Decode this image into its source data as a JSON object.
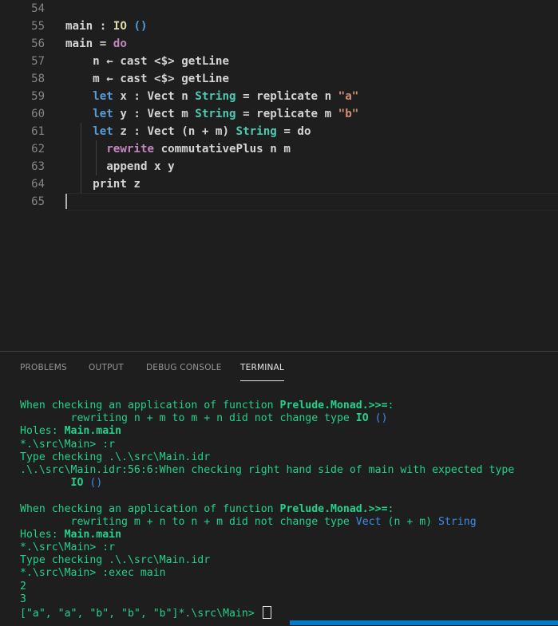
{
  "editor": {
    "lines": [
      {
        "num": "54",
        "segments": []
      },
      {
        "num": "55",
        "segments": [
          {
            "t": "main",
            "c": "pn"
          },
          {
            "t": " : ",
            "c": "pn"
          },
          {
            "t": "IO",
            "c": "fn"
          },
          {
            "t": " ",
            "c": "pn"
          },
          {
            "t": "()",
            "c": "kw2"
          }
        ]
      },
      {
        "num": "56",
        "segments": [
          {
            "t": "main",
            "c": "pn"
          },
          {
            "t": " = ",
            "c": "pn"
          },
          {
            "t": "do",
            "c": "kw"
          }
        ]
      },
      {
        "num": "57",
        "segments": [
          {
            "t": "    n ← cast ",
            "c": "pn"
          },
          {
            "t": "<$>",
            "c": "pn"
          },
          {
            "t": " getLine",
            "c": "pn"
          }
        ]
      },
      {
        "num": "58",
        "segments": [
          {
            "t": "    m ← cast ",
            "c": "pn"
          },
          {
            "t": "<$>",
            "c": "pn"
          },
          {
            "t": " getLine",
            "c": "pn"
          }
        ]
      },
      {
        "num": "59",
        "segments": [
          {
            "t": "    ",
            "c": "pn"
          },
          {
            "t": "let",
            "c": "kw2"
          },
          {
            "t": " x : Vect n ",
            "c": "pn"
          },
          {
            "t": "String",
            "c": "ty"
          },
          {
            "t": " = replicate n ",
            "c": "pn"
          },
          {
            "t": "\"a\"",
            "c": "str"
          }
        ]
      },
      {
        "num": "60",
        "segments": [
          {
            "t": "    ",
            "c": "pn"
          },
          {
            "t": "let",
            "c": "kw2"
          },
          {
            "t": " y : Vect m ",
            "c": "pn"
          },
          {
            "t": "String",
            "c": "ty"
          },
          {
            "t": " = replicate m ",
            "c": "pn"
          },
          {
            "t": "\"b\"",
            "c": "str"
          }
        ]
      },
      {
        "num": "61",
        "segments": [
          {
            "t": "    ",
            "c": "pn"
          },
          {
            "t": "let",
            "c": "kw2"
          },
          {
            "t": " z : Vect (n + m) ",
            "c": "pn"
          },
          {
            "t": "String",
            "c": "ty"
          },
          {
            "t": " = do",
            "c": "pn"
          }
        ]
      },
      {
        "num": "62",
        "segments": [
          {
            "t": "      ",
            "c": "pn"
          },
          {
            "t": "rewrite",
            "c": "kw"
          },
          {
            "t": " commutativePlus n m",
            "c": "pn"
          }
        ]
      },
      {
        "num": "63",
        "segments": [
          {
            "t": "      append x y",
            "c": "pn"
          }
        ]
      },
      {
        "num": "64",
        "segments": [
          {
            "t": "    print z",
            "c": "pn"
          }
        ]
      },
      {
        "num": "65",
        "segments": []
      }
    ]
  },
  "panel": {
    "tabs": [
      {
        "label": "PROBLEMS",
        "active": false
      },
      {
        "label": "OUTPUT",
        "active": false
      },
      {
        "label": "DEBUG CONSOLE",
        "active": false
      },
      {
        "label": "TERMINAL",
        "active": true
      }
    ]
  },
  "terminal": {
    "lines": [
      [
        {
          "t": "When checking an application of function "
        },
        {
          "t": "Prelude.Monad.>>=",
          "c": "b"
        },
        {
          "t": ":"
        }
      ],
      [
        {
          "t": "        rewriting n + m to m + n did not change type "
        },
        {
          "t": "IO",
          "c": "b"
        },
        {
          "t": " "
        },
        {
          "t": "()",
          "c": "blue"
        }
      ],
      [
        {
          "t": "Holes: "
        },
        {
          "t": "Main.main",
          "c": "b"
        }
      ],
      [
        {
          "t": "*.\\src\\Main> :r"
        }
      ],
      [
        {
          "t": "Type checking .\\.\\src\\Main.idr"
        }
      ],
      [
        {
          "t": ".\\.\\src\\Main.idr:56:6:When checking right hand side of main with expected type"
        }
      ],
      [
        {
          "t": "        "
        },
        {
          "t": "IO",
          "c": "b"
        },
        {
          "t": " "
        },
        {
          "t": "()",
          "c": "blue"
        }
      ],
      [
        {
          "t": ""
        }
      ],
      [
        {
          "t": "When checking an application of function "
        },
        {
          "t": "Prelude.Monad.>>=",
          "c": "b"
        },
        {
          "t": ":"
        }
      ],
      [
        {
          "t": "        rewriting m + n to n + m did not change type "
        },
        {
          "t": "Vect",
          "c": "blue"
        },
        {
          "t": " (n + m) "
        },
        {
          "t": "String",
          "c": "blue"
        }
      ],
      [
        {
          "t": "Holes: "
        },
        {
          "t": "Main.main",
          "c": "b"
        }
      ],
      [
        {
          "t": "*.\\src\\Main> :r"
        }
      ],
      [
        {
          "t": "Type checking .\\.\\src\\Main.idr"
        }
      ],
      [
        {
          "t": "*.\\src\\Main> :exec main"
        }
      ],
      [
        {
          "t": "2"
        }
      ],
      [
        {
          "t": "3"
        }
      ],
      [
        {
          "t": "[\"a\", \"a\", \"b\", \"b\", \"b\"]*.\\src\\Main> "
        }
      ]
    ]
  }
}
